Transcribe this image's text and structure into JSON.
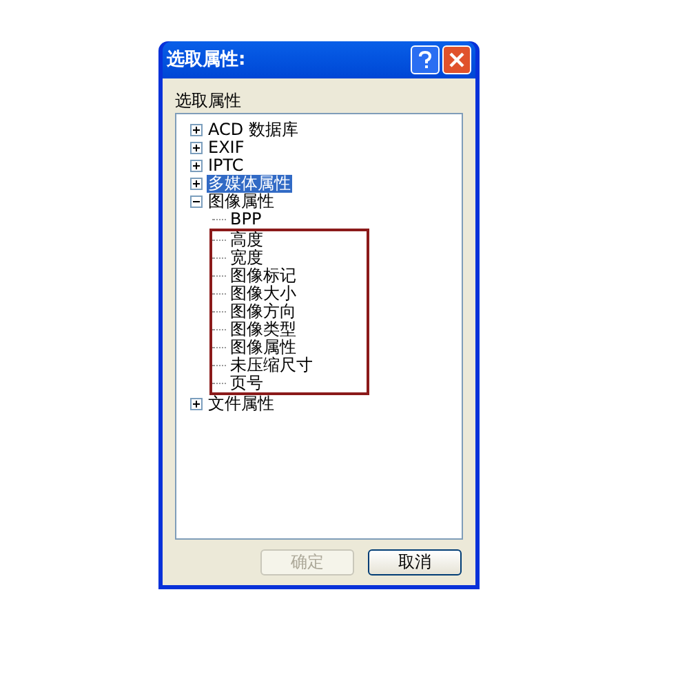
{
  "window": {
    "title": "选取属性:"
  },
  "tree_label": "选取属性",
  "tree": [
    {
      "label": "ACD 数据库",
      "expanded": false,
      "selected": false
    },
    {
      "label": "EXIF",
      "expanded": false,
      "selected": false
    },
    {
      "label": "IPTC",
      "expanded": false,
      "selected": false
    },
    {
      "label": "多媒体属性",
      "expanded": false,
      "selected": true
    },
    {
      "label": "图像属性",
      "expanded": true,
      "selected": false,
      "children": [
        {
          "label": "BPP",
          "highlighted": false
        },
        {
          "label": "高度",
          "highlighted": true
        },
        {
          "label": "宽度",
          "highlighted": true
        },
        {
          "label": "图像标记",
          "highlighted": true
        },
        {
          "label": "图像大小",
          "highlighted": true
        },
        {
          "label": "图像方向",
          "highlighted": true
        },
        {
          "label": "图像类型",
          "highlighted": true
        },
        {
          "label": "图像属性",
          "highlighted": true
        },
        {
          "label": "未压缩尺寸",
          "highlighted": true
        },
        {
          "label": "页号",
          "highlighted": true
        }
      ]
    },
    {
      "label": "文件属性",
      "expanded": false,
      "selected": false
    }
  ],
  "buttons": [
    {
      "label": "确定",
      "disabled": true
    },
    {
      "label": "取消",
      "disabled": false
    }
  ]
}
